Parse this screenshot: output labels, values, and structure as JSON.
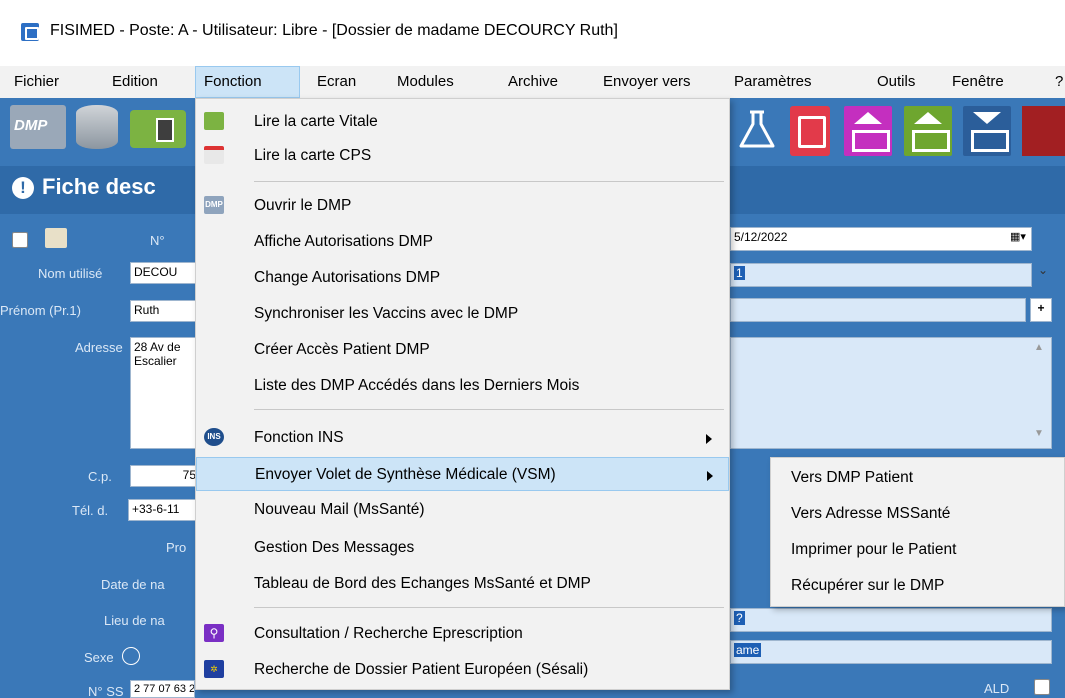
{
  "window": {
    "title": "FISIMED - Poste: A - Utilisateur: Libre - [Dossier de madame DECOURCY Ruth]"
  },
  "menubar": {
    "items": [
      "Fichier",
      "Edition",
      "Fonction",
      "Ecran",
      "Modules",
      "Archive",
      "Envoyer vers",
      "Paramètres",
      "Outils",
      "Fenêtre",
      "?"
    ],
    "active": "Fonction"
  },
  "toolbar": {
    "dmp_label": "DMP",
    "icons": [
      "dmp-icon",
      "database-icon",
      "vitale-card-icon",
      "flask-icon",
      "document-icon",
      "inbox-up-icon",
      "inbox-up-green-icon",
      "inbox-down-icon",
      "book-icon"
    ],
    "colors": {
      "pink": "#c42fbf",
      "green": "#6ea62f",
      "navy": "#2b5e9a",
      "red": "#e23a4a",
      "darkred": "#a21f22"
    }
  },
  "form": {
    "header_title": "Fiche desc",
    "labels": {
      "no": "N°",
      "nom": "Nom utilisé",
      "prenom": "Prénom (Pr.1)",
      "adresse": "Adresse",
      "cp": "C.p.",
      "tel": "Tél. d.",
      "pro": "Pro",
      "date_naissance": "Date de na",
      "lieu_naissance": "Lieu de na",
      "sexe": "Sexe",
      "nss": "N° SS",
      "ald": "ALD"
    },
    "values": {
      "nom": "DECOU",
      "prenom": "Ruth",
      "adresse_l1": "28 Av de",
      "adresse_l2": "Escalier",
      "cp": "75",
      "tel": "+33-6-11",
      "date": "5/12/2022",
      "nss": "2 77 07 63 220 829 10",
      "right_field1": "1",
      "right_field2": "?",
      "right_field3": "ame"
    }
  },
  "dropdown": {
    "items": [
      {
        "label": "Lire la carte Vitale",
        "icon": "vitale-card-icon"
      },
      {
        "label": "Lire la carte CPS",
        "icon": "cps-card-icon"
      },
      {
        "label": "Ouvrir le DMP",
        "icon": "dmp-icon"
      },
      {
        "label": "Affiche Autorisations DMP"
      },
      {
        "label": "Change Autorisations DMP"
      },
      {
        "label": "Synchroniser les Vaccins avec le DMP"
      },
      {
        "label": "Créer Accès Patient DMP"
      },
      {
        "label": "Liste des DMP Accédés dans les Derniers Mois"
      },
      {
        "label": "Fonction INS",
        "icon": "ins-icon",
        "submenu": true
      },
      {
        "label": "Envoyer Volet de Synthèse Médicale (VSM)",
        "submenu": true,
        "highlighted": true
      },
      {
        "label": "Nouveau Mail (MsSanté)"
      },
      {
        "label": "Gestion Des Messages"
      },
      {
        "label": "Tableau de Bord des Echanges MsSanté et DMP"
      },
      {
        "label": "Consultation / Recherche Eprescription",
        "icon": "search-icon"
      },
      {
        "label": "Recherche de Dossier Patient Européen (Sésali)",
        "icon": "eu-flag-icon"
      }
    ]
  },
  "submenu": {
    "items": [
      "Vers DMP Patient",
      "Vers Adresse MSSanté",
      "Imprimer pour le Patient",
      "Récupérer sur le DMP"
    ]
  }
}
